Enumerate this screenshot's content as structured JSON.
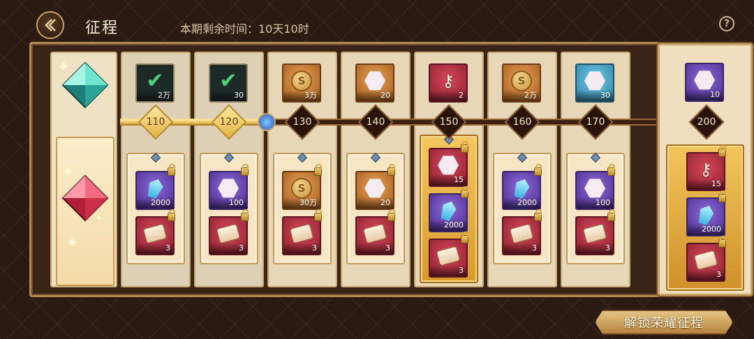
{
  "header": {
    "title": "征程",
    "time_label": "本期剩余时间：10天10时",
    "help": "?"
  },
  "columns": [
    {
      "level": "110",
      "done": true,
      "free": {
        "kind": "claimed",
        "qty": "2万"
      },
      "premium": [
        {
          "kind": "crystal",
          "color": "purple",
          "qty": "2000"
        },
        {
          "kind": "ticket",
          "color": "red",
          "qty": "3"
        }
      ]
    },
    {
      "level": "120",
      "done": true,
      "free": {
        "kind": "claimed",
        "qty": "30"
      },
      "premium": [
        {
          "kind": "paw",
          "color": "purple",
          "qty": "100"
        },
        {
          "kind": "ticket",
          "color": "red",
          "qty": "3"
        }
      ]
    },
    {
      "level": "130",
      "done": false,
      "free": {
        "kind": "coin",
        "color": "orange",
        "qty": "3万"
      },
      "premium": [
        {
          "kind": "coin",
          "color": "orange",
          "qty": "30万"
        },
        {
          "kind": "ticket",
          "color": "red",
          "qty": "3"
        }
      ]
    },
    {
      "level": "140",
      "done": false,
      "free": {
        "kind": "paw",
        "color": "orange",
        "qty": "20"
      },
      "premium": [
        {
          "kind": "paw",
          "color": "orange",
          "qty": "20"
        },
        {
          "kind": "ticket",
          "color": "red",
          "qty": "3"
        }
      ]
    },
    {
      "level": "150",
      "done": false,
      "free": {
        "kind": "key",
        "color": "red",
        "qty": "2"
      },
      "premium": [
        {
          "kind": "paw",
          "color": "red",
          "qty": "15"
        },
        {
          "kind": "crystal",
          "color": "purple",
          "qty": "2000"
        },
        {
          "kind": "ticket",
          "color": "red",
          "qty": "3"
        }
      ]
    },
    {
      "level": "160",
      "done": false,
      "free": {
        "kind": "coin",
        "color": "orange",
        "qty": "2万"
      },
      "premium": [
        {
          "kind": "crystal",
          "color": "purple",
          "qty": "2000"
        },
        {
          "kind": "ticket",
          "color": "red",
          "qty": "3"
        }
      ]
    },
    {
      "level": "170",
      "done": false,
      "free": {
        "kind": "paw",
        "color": "teal",
        "qty": "30"
      },
      "premium": [
        {
          "kind": "paw",
          "color": "purple",
          "qty": "100"
        },
        {
          "kind": "ticket",
          "color": "red",
          "qty": "3"
        }
      ]
    }
  ],
  "preview": {
    "level": "200",
    "free": {
      "kind": "paw",
      "color": "purple",
      "qty": "10"
    },
    "premium": [
      {
        "kind": "key",
        "color": "red",
        "qty": "15"
      },
      {
        "kind": "crystal",
        "color": "purple",
        "qty": "2000"
      },
      {
        "kind": "ticket",
        "color": "red",
        "qty": "3"
      }
    ]
  },
  "unlock_button": "解锁荣耀征程",
  "colors": {
    "accent_gold": "#d7a53a",
    "panel_bg": "#e8d7b6",
    "background": "#2b1a12"
  }
}
